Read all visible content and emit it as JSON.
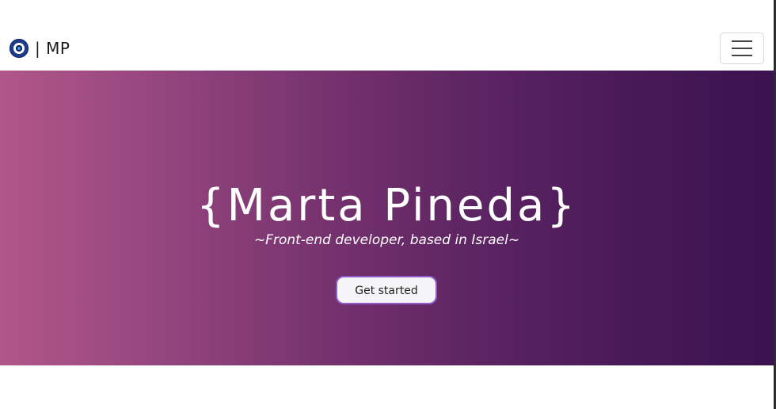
{
  "navbar": {
    "brand_text": "| MP",
    "logo_icon": "evil-eye-icon",
    "menu_icon": "hamburger-menu-icon"
  },
  "hero": {
    "title": "{Marta Pineda}",
    "subtitle": "~Front-end developer, based in Israel~",
    "cta_label": "Get started"
  },
  "colors": {
    "gradient_start": "#b0568a",
    "gradient_end": "#3b1250",
    "cta_border": "#8e5bc9"
  }
}
